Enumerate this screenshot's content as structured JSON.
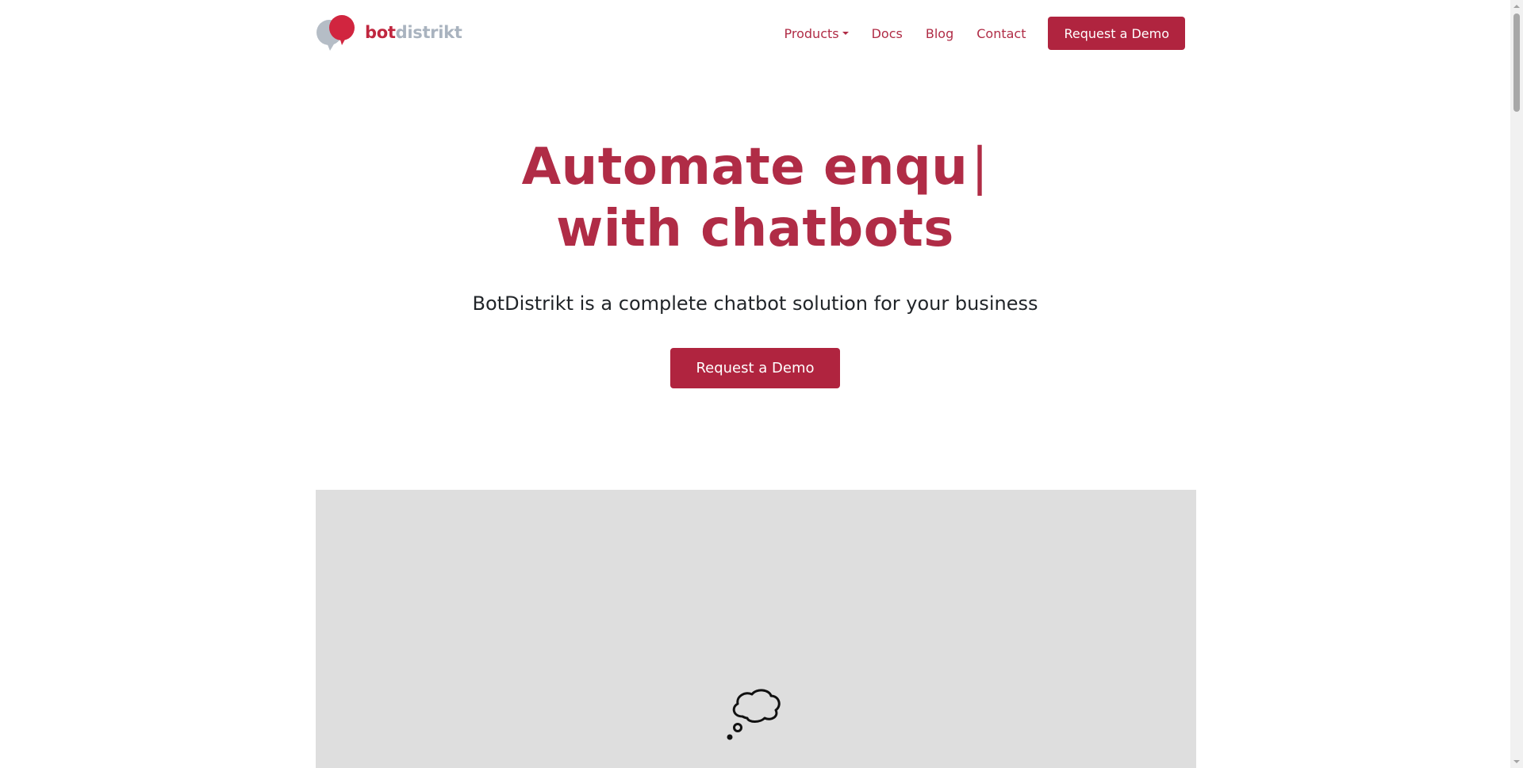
{
  "brand": {
    "name_part1": "bot",
    "name_part2": "distrikt",
    "colors": {
      "primary": "#b0243f",
      "logo_accent": "#c0273f",
      "logo_muted": "#a9b3bf"
    }
  },
  "nav": {
    "items": [
      {
        "label": "Products",
        "has_dropdown": true
      },
      {
        "label": "Docs"
      },
      {
        "label": "Blog"
      },
      {
        "label": "Contact"
      }
    ],
    "cta_label": "Request a Demo"
  },
  "hero": {
    "title_line1": "Automate enqu",
    "title_cursor": "|",
    "title_line2": "with chatbots",
    "subtitle": "BotDistrikt is a complete chatbot solution for your business",
    "cta_label": "Request a Demo"
  },
  "media": {
    "icon": "thought-bubble-icon"
  }
}
